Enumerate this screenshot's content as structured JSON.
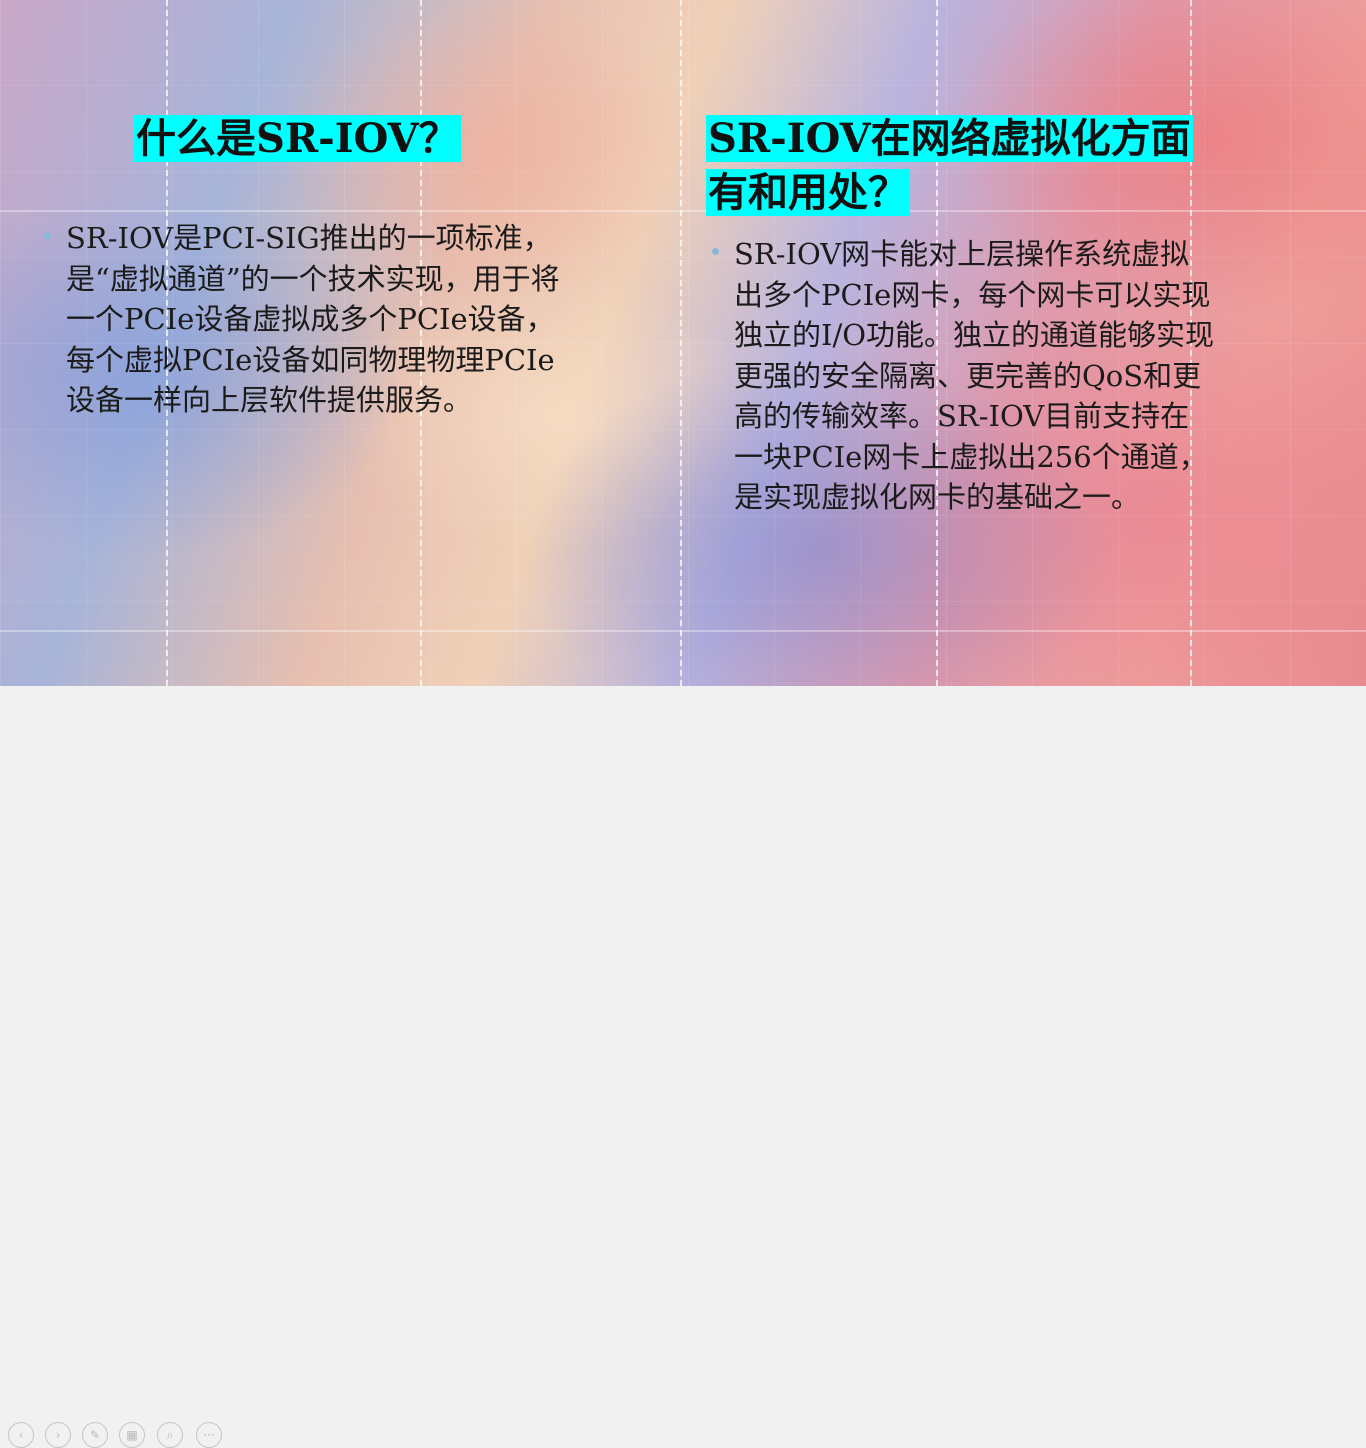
{
  "slide": {
    "left_title": "什么是SR-IOV？",
    "left_body": "SR-IOV是PCI-SIG推出的一项标准，是“虚拟通道”的一个技术实现，用于将一个PCIe设备虚拟成多个PCIe设备，每个虚拟PCIe设备如同物理物理PCIe设备一样向上层软件提供服务。",
    "right_title": "SR-IOV在网络虚拟化方面有和用处？",
    "right_body": "SR-IOV网卡能对上层操作系统虚拟出多个PCIe网卡，每个网卡可以实现独立的I/O功能。独立的通道能够实现更强的安全隔离、更完善的QoS和更高的传输效率。SR-IOV目前支持在一块PCIe网卡上虚拟出256个通道，是实现虚拟化网卡的基础之一。"
  },
  "colors": {
    "title_highlight": "#00ffff",
    "bullet": "#8ab6d8"
  },
  "toolbar": {
    "buttons": [
      {
        "name": "previous-slide-button",
        "icon": "chevron-left-icon",
        "glyph": "‹"
      },
      {
        "name": "next-slide-button",
        "icon": "chevron-right-icon",
        "glyph": "›"
      },
      {
        "name": "pen-button",
        "icon": "pen-icon",
        "glyph": "✎"
      },
      {
        "name": "slides-grid-button",
        "icon": "grid-icon",
        "glyph": "▦"
      },
      {
        "name": "zoom-button",
        "icon": "magnifier-icon",
        "glyph": "⌕"
      },
      {
        "name": "more-options-button",
        "icon": "ellipsis-icon",
        "glyph": "···"
      }
    ]
  }
}
